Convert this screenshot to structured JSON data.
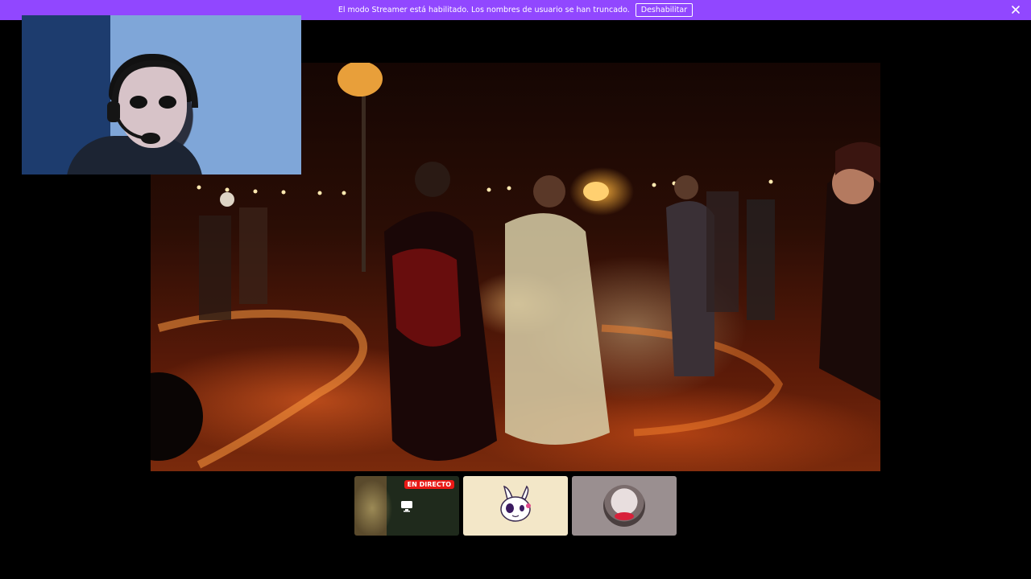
{
  "banner": {
    "message": "El modo Streamer está habilitado. Los nombres de usuario se han truncado.",
    "button_label": "Deshabilitar",
    "close_icon": "close-icon",
    "color": "#9147ff"
  },
  "stage": {
    "main_stream": "video-stream",
    "camera_overlay": "webcam-feed"
  },
  "thumbnails": [
    {
      "badge": "EN DIRECTO",
      "icon": "monitor-icon",
      "badge_color": "#e91916"
    },
    {
      "icon": "bunny-avatar-icon"
    },
    {
      "icon": "user-avatar"
    }
  ]
}
